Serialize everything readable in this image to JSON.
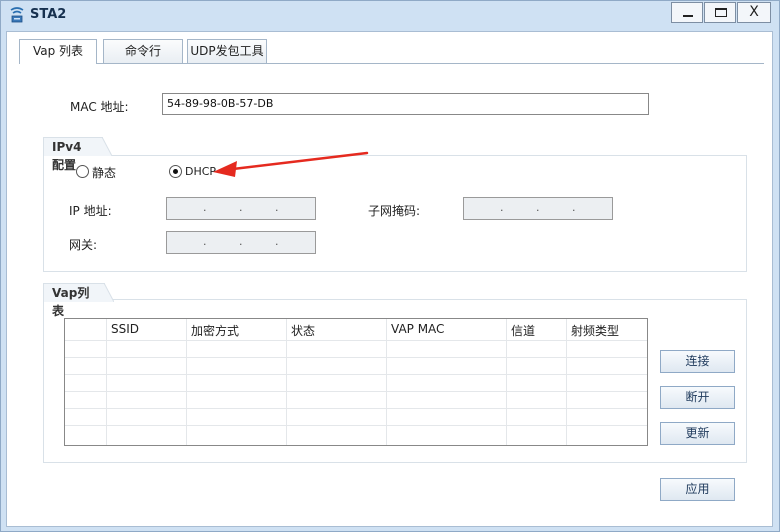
{
  "window": {
    "title": "STA2",
    "minimize_icon": "minimize-icon",
    "maximize_icon": "maximize-icon",
    "close_label": "X"
  },
  "tabs": [
    {
      "label": "Vap 列表",
      "active": true
    },
    {
      "label": "命令行",
      "active": false
    },
    {
      "label": "UDP发包工具",
      "active": false
    }
  ],
  "mac": {
    "label": "MAC 地址:",
    "value": "54-89-98-0B-57-DB"
  },
  "ipv4": {
    "title": "IPv4 配置",
    "static_label": "静态",
    "dhcp_label": "DHCP",
    "selected": "DHCP",
    "ip_label": "IP 地址:",
    "subnet_label": "子网掩码:",
    "gateway_label": "网关:"
  },
  "vap": {
    "title": "Vap列表",
    "columns": [
      "SSID",
      "加密方式",
      "状态",
      "VAP MAC",
      "信道",
      "射频类型"
    ],
    "rows": []
  },
  "buttons": {
    "connect": "连接",
    "disconnect": "断开",
    "refresh": "更新",
    "apply": "应用"
  },
  "colors": {
    "annotation_arrow": "#e52a1f",
    "window_frame": "#cfe1f3"
  }
}
